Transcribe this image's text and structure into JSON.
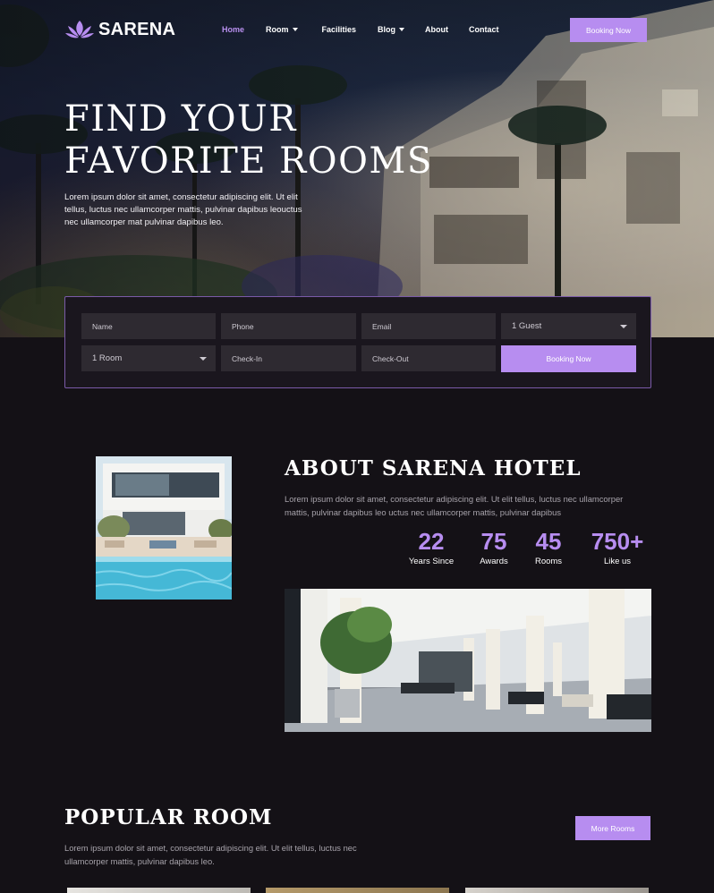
{
  "brand": {
    "name": "SARENA"
  },
  "nav": {
    "items": [
      {
        "label": "Home",
        "active": true,
        "dropdown": false
      },
      {
        "label": "Room",
        "active": false,
        "dropdown": true
      },
      {
        "label": "Facilities",
        "active": false,
        "dropdown": false
      },
      {
        "label": "Blog",
        "active": false,
        "dropdown": true
      },
      {
        "label": "About",
        "active": false,
        "dropdown": false
      },
      {
        "label": "Contact",
        "active": false,
        "dropdown": false
      }
    ],
    "cta_label": "Booking Now"
  },
  "hero": {
    "title_line1": "FIND YOUR",
    "title_line2": "FAVORITE ROOMS",
    "text": "Lorem ipsum dolor sit amet, consectetur adipiscing elit. Ut elit tellus, luctus nec ullamcorper mattis, pulvinar dapibus leouctus nec ullamcorper mat pulvinar dapibus leo."
  },
  "booking": {
    "name_placeholder": "Name",
    "phone_placeholder": "Phone",
    "email_placeholder": "Email",
    "guest_value": "1 Guest",
    "room_value": "1 Room",
    "checkin_placeholder": "Check-In",
    "checkout_placeholder": "Check-Out",
    "submit_label": "Booking Now"
  },
  "about": {
    "title": "ABOUT SARENA HOTEL",
    "text": "Lorem ipsum dolor sit amet, consectetur adipiscing elit. Ut elit tellus, luctus nec ullamcorper mattis, pulvinar dapibus leo uctus nec ullamcorper mattis, pulvinar dapibus",
    "stats": [
      {
        "value": "22",
        "label": "Years Since"
      },
      {
        "value": "75",
        "label": "Awards"
      },
      {
        "value": "45",
        "label": "Rooms"
      },
      {
        "value": "750+",
        "label": "Like us"
      }
    ]
  },
  "popular": {
    "title": "POPULAR ROOM",
    "text": "Lorem ipsum dolor sit amet, consectetur adipiscing elit. Ut elit tellus, luctus nec ullamcorper mattis, pulvinar dapibus leo.",
    "more_label": "More Rooms"
  },
  "colors": {
    "accent": "#b78df0",
    "background": "#141116",
    "field": "#2e2a31"
  }
}
